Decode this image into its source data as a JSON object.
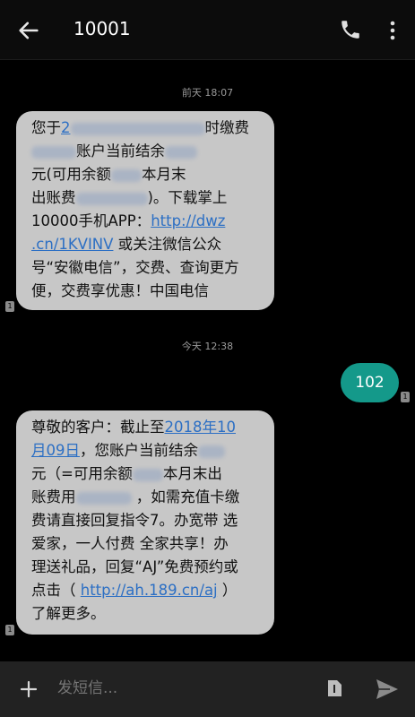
{
  "header": {
    "title": "10001",
    "back_icon": "arrow-left-icon",
    "call_icon": "phone-icon",
    "more_icon": "more-vertical-icon"
  },
  "messages": [
    {
      "timestamp": "前天 18:07",
      "direction": "incoming",
      "lines": {
        "l1a": "您于",
        "l1link": "2",
        "l1b": "时缴费",
        "l2": "账户当前结余",
        "l3a": "元(可用余额",
        "l3b": "本月末",
        "l4a": "出账费",
        "l4b": ")。下载掌上",
        "l5a": "10000手机APP：",
        "l5link": "http://dwz",
        "l6link": ".cn/1KVINV",
        "l6b": " 或关注微信公众",
        "l7": "号“安徽电信”，交费、查询更方",
        "l8": "便，交费享优惠！中国电信"
      },
      "sim": "1"
    },
    {
      "timestamp": "今天 12:38",
      "direction": "outgoing",
      "text": "102",
      "sim": "1"
    },
    {
      "direction": "incoming",
      "lines": {
        "l1a": "尊敬的客户：截止至",
        "l1link": "2018年10",
        "l2link": "月09日",
        "l2b": "，您账户当前结余",
        "l3a": "元（=可用余额",
        "l3b": "本月末出",
        "l4a": "账费用",
        "l4b": " ，如需充值卡缴",
        "l5": "费请直接回复指令7。办宽带 选",
        "l6": "爱家，一人付费 全家共享！办",
        "l7": "理送礼品，回复“AJ”免费预约或",
        "l8a": "点击（ ",
        "l8link": "http://ah.189.cn/aj",
        "l8b": " ）",
        "l9": "了解更多。"
      },
      "sim": "1"
    }
  ],
  "composer": {
    "placeholder": "发短信...",
    "add_icon": "plus-icon",
    "sim_icon": "sim-card-icon",
    "send_icon": "send-icon"
  },
  "colors": {
    "background": "#000000",
    "incoming_bubble": "#c7c7c7",
    "outgoing_bubble": "#14998a",
    "link": "#2c6fc4"
  }
}
